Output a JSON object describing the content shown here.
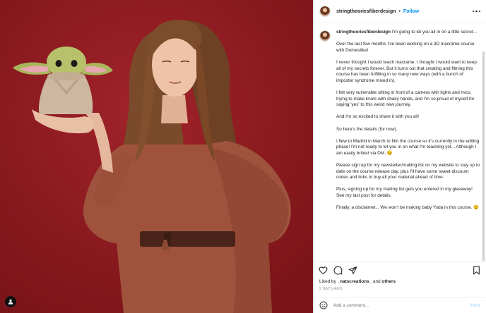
{
  "header": {
    "username": "stringtheoriesfiberdesign",
    "separator": "•",
    "follow_label": "Follow"
  },
  "caption": {
    "username": "stringtheoriesfiberdesign",
    "first_line": "I'm going to let you all in on a little secret...",
    "paragraphs": [
      "Over the last few months I've been working on a 3D macrame course with Domestika!",
      "I never thought I would teach macrame. I thought I would want to keep all of my secrets forever. But it turns out that creating and filming this course has been fulfilling in so many new ways (with a bunch of imposter syndrome mixed in).",
      "I felt very vulnerable sitting in front of a camera with lights and mics, trying to make knots with shaky hands, and I'm so proud of myself for saying 'yes' to this weird new journey.",
      "And I'm so excited to share it with you all!",
      "So here's the details (for now).",
      "I flew to Madrid in March to film the course so it's currently in the editing phase! I'm not ready to let you in on what I'm teaching yet... Although I am easily bribed via DM. 😉",
      "Please sign up for my newsletter/mailing list on my website to stay up to date on the course release day, plus I'll have some sweet discount codes and links to buy all your material ahead of time.",
      "Plus, signing up for my mailing list gets you entered in my giveaway! See my last post for details.",
      "Finally, a disclaimer... We won't be making baby Yoda in this course. 😉"
    ]
  },
  "likes": {
    "prefix": "Liked by",
    "user": "_natscreations_",
    "joiner": "and",
    "others": "others"
  },
  "timestamp": "2 DAYS AGO",
  "comment": {
    "placeholder": "Add a comment...",
    "post_label": "Post"
  },
  "colors": {
    "background_red": "#8e1a1f",
    "follow_blue": "#0095f6",
    "post_disabled": "#b3dbff"
  }
}
